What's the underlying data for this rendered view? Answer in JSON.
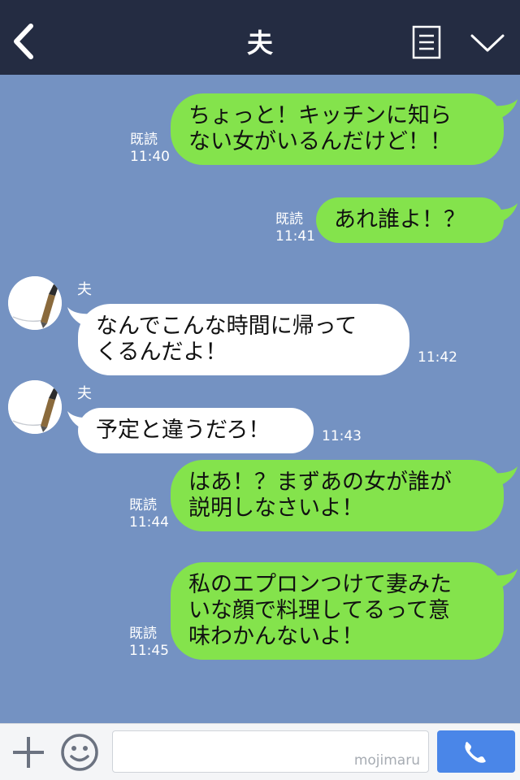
{
  "header": {
    "title": "夫"
  },
  "messages": [
    {
      "side": "me",
      "lines": [
        "ちょっと！キッチンに知ら",
        "ない女がいるんだけど！！"
      ],
      "read": "既読",
      "time": "11:40"
    },
    {
      "side": "me",
      "lines": [
        "あれ誰よ！？"
      ],
      "read": "既読",
      "time": "11:41"
    },
    {
      "side": "other",
      "sender": "夫",
      "lines": [
        "なんでこんな時間に帰って",
        "くるんだよ！"
      ],
      "time": "11:42"
    },
    {
      "side": "other",
      "sender": "夫",
      "lines": [
        "予定と違うだろ！"
      ],
      "time": "11:43"
    },
    {
      "side": "me",
      "lines": [
        "はあ！？まずあの女が誰が",
        "説明しなさいよ！"
      ],
      "read": "既読",
      "time": "11:44"
    },
    {
      "side": "me",
      "lines": [
        "私のエプロンつけて妻みた",
        "いな顔で料理してるって意",
        "味わかんないよ！"
      ],
      "read": "既読",
      "time": "11:45"
    }
  ],
  "footer": {
    "watermark": "mojimaru"
  },
  "colors": {
    "header_bg": "#242c42",
    "chat_bg": "#7492c2",
    "my_bubble": "#84e34c",
    "their_bubble": "#ffffff",
    "call_button": "#4a86e8"
  },
  "icons": [
    "back-chevron-icon",
    "menu-list-icon",
    "chevron-down-icon",
    "plus-icon",
    "emoji-icon",
    "phone-icon"
  ]
}
